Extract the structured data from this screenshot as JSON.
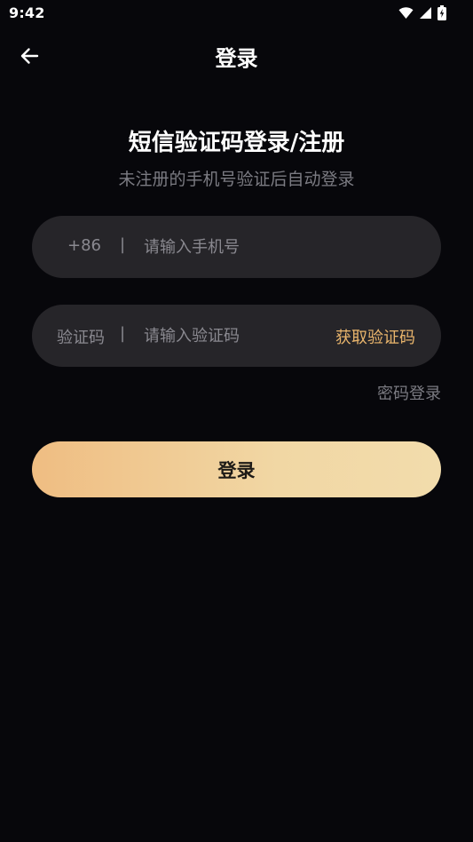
{
  "status_bar": {
    "time": "9:42",
    "icons": [
      "wifi-icon",
      "cellular-signal-icon",
      "battery-charging-icon"
    ]
  },
  "header": {
    "title": "登录",
    "back_icon": "arrow-left-icon"
  },
  "heading": {
    "title": "短信验证码登录/注册",
    "subtitle": "未注册的手机号验证后自动登录"
  },
  "phone_field": {
    "prefix": "+86",
    "separator": "|",
    "placeholder": "请输入手机号",
    "value": ""
  },
  "code_field": {
    "prefix": "验证码",
    "separator": "|",
    "placeholder": "请输入验证码",
    "value": "",
    "get_code_label": "获取验证码"
  },
  "password_login_label": "密码登录",
  "login_button_label": "登录",
  "colors": {
    "background": "#07070b",
    "field_background": "#262529",
    "accent": "#e9b56c",
    "button_gradient_start": "#efbd82",
    "button_gradient_end": "#f2dcac"
  }
}
